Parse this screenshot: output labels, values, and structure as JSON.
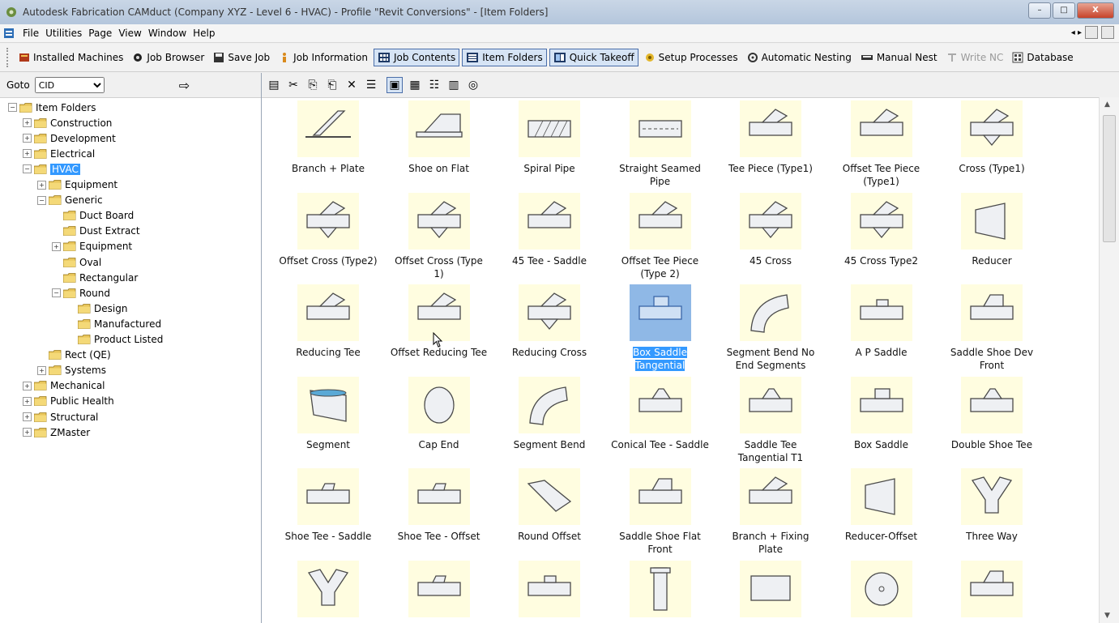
{
  "window": {
    "title": "Autodesk Fabrication CAMduct (Company XYZ - Level 6 - HVAC) - Profile \"Revit Conversions\" - [Item Folders]",
    "minimize_icon": "minimize-icon",
    "maximize_icon": "maximize-icon",
    "close_label": "X"
  },
  "menubar": {
    "items": [
      "File",
      "Utilities",
      "Page",
      "View",
      "Window",
      "Help"
    ],
    "nav_arrows": "◂ ▸"
  },
  "toolbar": {
    "buttons": [
      {
        "label": "Installed Machines",
        "icon": "machine-icon"
      },
      {
        "label": "Job Browser",
        "icon": "browser-icon"
      },
      {
        "label": "Save Job",
        "icon": "save-icon"
      },
      {
        "label": "Job Information",
        "icon": "info-icon"
      },
      {
        "label": "Job Contents",
        "icon": "grid-icon",
        "active": true
      },
      {
        "label": "Item Folders",
        "icon": "folder-list-icon",
        "active": true
      },
      {
        "label": "Quick Takeoff",
        "icon": "takeoff-icon",
        "active": true
      },
      {
        "label": "Setup Processes",
        "icon": "processes-icon"
      },
      {
        "label": "Automatic Nesting",
        "icon": "nesting-icon"
      },
      {
        "label": "Manual Nest",
        "icon": "manual-nest-icon"
      },
      {
        "label": "Write NC",
        "icon": "write-nc-icon",
        "disabled": true
      },
      {
        "label": "Database",
        "icon": "database-icon"
      }
    ]
  },
  "goto": {
    "label": "Goto",
    "selected": "CID",
    "go_icon": "⇨"
  },
  "tree": [
    {
      "label": "Item Folders",
      "level": 0,
      "exp": "-"
    },
    {
      "label": "Construction",
      "level": 1,
      "exp": "+"
    },
    {
      "label": "Development",
      "level": 1,
      "exp": "+"
    },
    {
      "label": "Electrical",
      "level": 1,
      "exp": "+"
    },
    {
      "label": "HVAC",
      "level": 1,
      "exp": "-",
      "selected": true
    },
    {
      "label": "Equipment",
      "level": 2,
      "exp": "+"
    },
    {
      "label": "Generic",
      "level": 2,
      "exp": "-"
    },
    {
      "label": "Duct Board",
      "level": 3,
      "exp": ""
    },
    {
      "label": "Dust Extract",
      "level": 3,
      "exp": ""
    },
    {
      "label": "Equipment",
      "level": 3,
      "exp": "+"
    },
    {
      "label": "Oval",
      "level": 3,
      "exp": ""
    },
    {
      "label": "Rectangular",
      "level": 3,
      "exp": ""
    },
    {
      "label": "Round",
      "level": 3,
      "exp": "-"
    },
    {
      "label": "Design",
      "level": 4,
      "exp": ""
    },
    {
      "label": "Manufactured",
      "level": 4,
      "exp": ""
    },
    {
      "label": "Product Listed",
      "level": 4,
      "exp": ""
    },
    {
      "label": "Rect (QE)",
      "level": 2,
      "exp": ""
    },
    {
      "label": "Systems",
      "level": 2,
      "exp": "+"
    },
    {
      "label": "Mechanical",
      "level": 1,
      "exp": "+"
    },
    {
      "label": "Public Health",
      "level": 1,
      "exp": "+"
    },
    {
      "label": "Structural",
      "level": 1,
      "exp": "+"
    },
    {
      "label": "ZMaster",
      "level": 1,
      "exp": "+"
    }
  ],
  "icon_toolbar": [
    "new-item-icon",
    "cut-icon",
    "copy-icon",
    "paste-icon",
    "delete-icon",
    "properties-icon",
    "large-icons-view-icon",
    "small-icons-view-icon",
    "list-view-icon",
    "details-view-icon",
    "search-item-icon"
  ],
  "items": [
    {
      "label": "Branch + Plate",
      "shape": "branch"
    },
    {
      "label": "Shoe on Flat",
      "shape": "shoeflat"
    },
    {
      "label": "Spiral Pipe",
      "shape": "spiral"
    },
    {
      "label": "Straight Seamed Pipe",
      "shape": "seamed"
    },
    {
      "label": "Tee Piece (Type1)",
      "shape": "tee"
    },
    {
      "label": "Offset Tee Piece (Type1)",
      "shape": "tee"
    },
    {
      "label": "Cross (Type1)",
      "shape": "cross"
    },
    {
      "label": "Offset Cross (Type2)",
      "shape": "cross"
    },
    {
      "label": "Offset Cross (Type 1)",
      "shape": "cross"
    },
    {
      "label": "45 Tee - Saddle",
      "shape": "tee"
    },
    {
      "label": "Offset Tee Piece (Type 2)",
      "shape": "tee"
    },
    {
      "label": "45 Cross",
      "shape": "cross"
    },
    {
      "label": "45 Cross Type2",
      "shape": "cross"
    },
    {
      "label": "Reducer",
      "shape": "reducer"
    },
    {
      "label": "Reducing Tee",
      "shape": "tee"
    },
    {
      "label": "Offset Reducing Tee",
      "shape": "tee"
    },
    {
      "label": "Reducing Cross",
      "shape": "cross"
    },
    {
      "label": "Box Saddle Tangential",
      "shape": "boxsaddle",
      "selected": true
    },
    {
      "label": "Segment Bend No End Segments",
      "shape": "bend"
    },
    {
      "label": "A P Saddle",
      "shape": "apsaddle"
    },
    {
      "label": "Saddle Shoe Dev Front",
      "shape": "shoe"
    },
    {
      "label": "Segment",
      "shape": "segment"
    },
    {
      "label": "Cap End",
      "shape": "cap"
    },
    {
      "label": "Segment Bend",
      "shape": "bend"
    },
    {
      "label": "Conical Tee - Saddle",
      "shape": "conical"
    },
    {
      "label": "Saddle Tee Tangential T1",
      "shape": "conical"
    },
    {
      "label": "Box Saddle",
      "shape": "boxsaddle"
    },
    {
      "label": "Double Shoe Tee",
      "shape": "conical"
    },
    {
      "label": "Shoe Tee - Saddle",
      "shape": "shoetee"
    },
    {
      "label": "Shoe Tee - Offset",
      "shape": "shoetee"
    },
    {
      "label": "Round Offset",
      "shape": "offset"
    },
    {
      "label": "Saddle Shoe Flat Front",
      "shape": "shoe"
    },
    {
      "label": "Branch + Fixing Plate",
      "shape": "tee"
    },
    {
      "label": "Reducer-Offset",
      "shape": "reducer"
    },
    {
      "label": "Three Way",
      "shape": "threeway"
    },
    {
      "label": "",
      "shape": "threeway"
    },
    {
      "label": "",
      "shape": "shoetee"
    },
    {
      "label": "",
      "shape": "apsaddle"
    },
    {
      "label": "",
      "shape": "vertical"
    },
    {
      "label": "",
      "shape": "pipe"
    },
    {
      "label": "",
      "shape": "disc"
    },
    {
      "label": "",
      "shape": "shoe"
    }
  ]
}
